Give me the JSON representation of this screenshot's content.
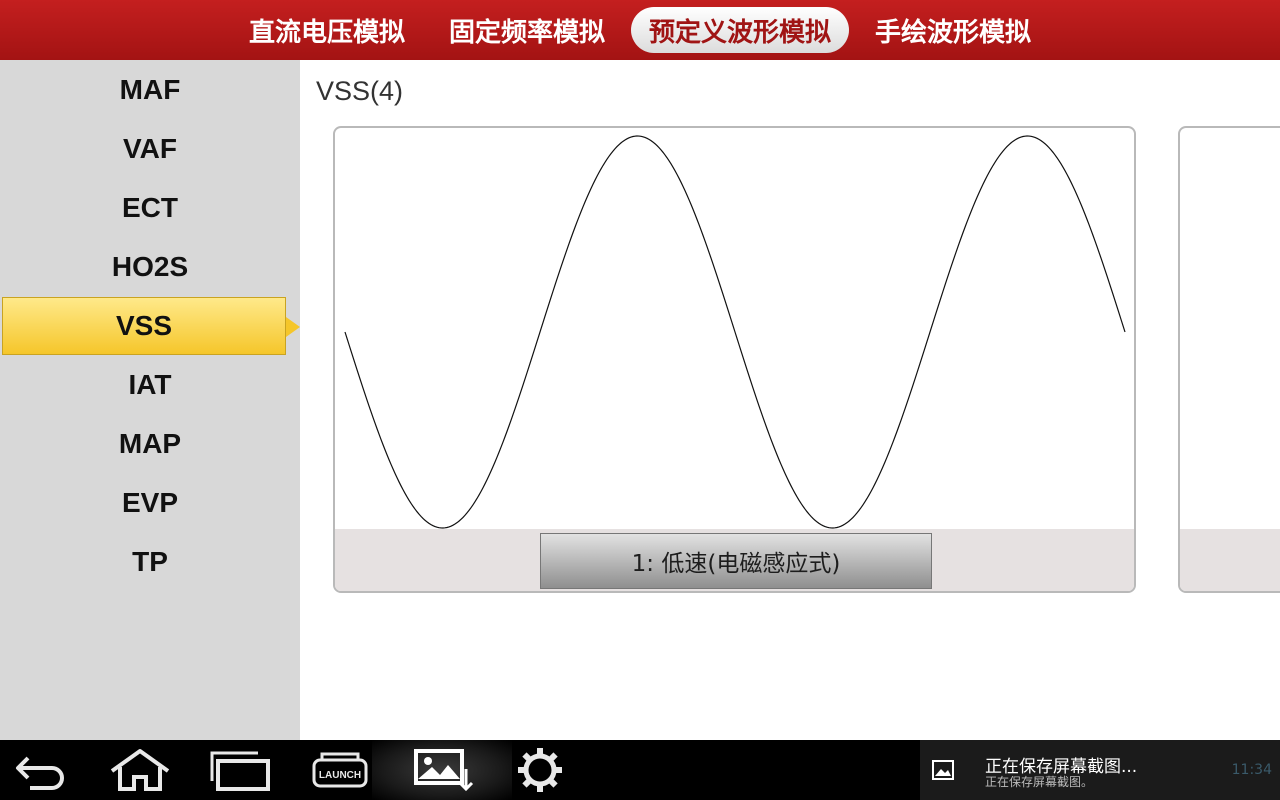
{
  "tabs": [
    {
      "label": "直流电压模拟",
      "active": false
    },
    {
      "label": "固定频率模拟",
      "active": false
    },
    {
      "label": "预定义波形模拟",
      "active": true
    },
    {
      "label": "手绘波形模拟",
      "active": false
    }
  ],
  "sidebar": {
    "items": [
      {
        "label": "MAF"
      },
      {
        "label": "VAF"
      },
      {
        "label": "ECT"
      },
      {
        "label": "HO2S"
      },
      {
        "label": "VSS",
        "active": true
      },
      {
        "label": "IAT"
      },
      {
        "label": "MAP"
      },
      {
        "label": "EVP"
      },
      {
        "label": "TP"
      }
    ]
  },
  "main": {
    "title": "VSS(4)",
    "cards": [
      {
        "button_label": "1: 低速(电磁感应式)",
        "wave": "sine"
      }
    ]
  },
  "navbar": {
    "icons": [
      "back-icon",
      "home-icon",
      "recent-apps-icon",
      "launch-icon",
      "screenshot-icon",
      "settings-icon"
    ]
  },
  "notification": {
    "title": "正在保存屏幕截图...",
    "subtitle": "正在保存屏幕截图。",
    "time": "11:34"
  },
  "colors": {
    "topbar": "#b51919",
    "sidebar": "#d8d8d8",
    "active_item": "#f5c62a"
  }
}
